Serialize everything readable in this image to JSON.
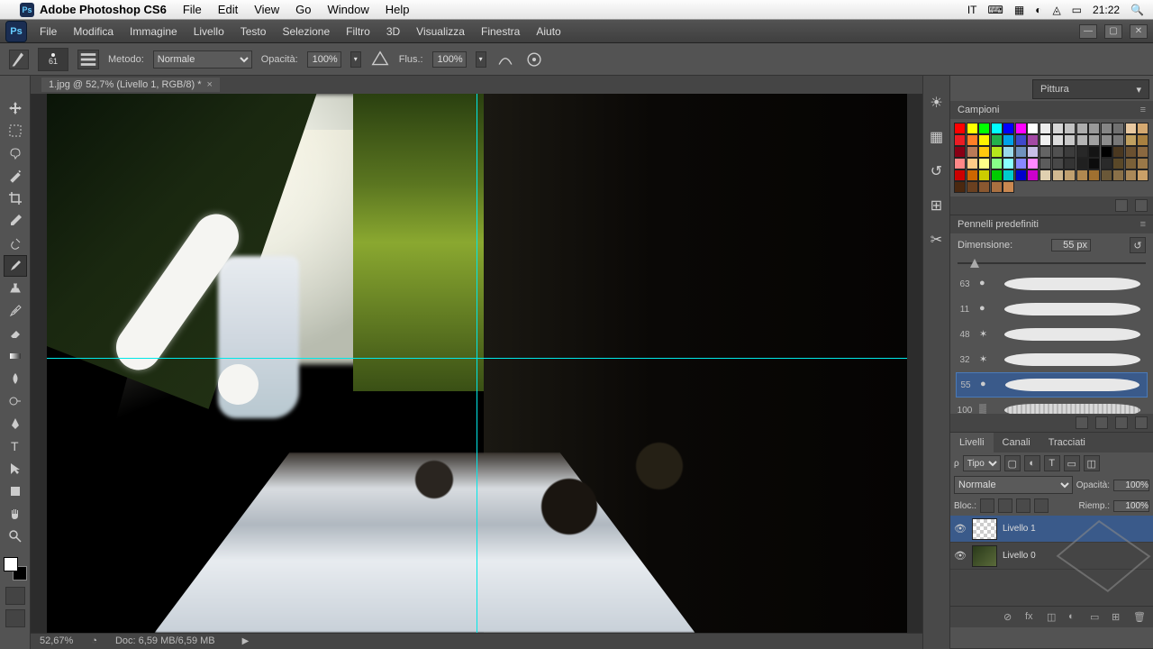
{
  "mac_menu": {
    "app_name": "Adobe Photoshop CS6",
    "items": [
      "File",
      "Edit",
      "View",
      "Go",
      "Window",
      "Help"
    ],
    "input_lang": "IT",
    "clock": "21:22"
  },
  "ps_menu": {
    "items": [
      "File",
      "Modifica",
      "Immagine",
      "Livello",
      "Testo",
      "Selezione",
      "Filtro",
      "3D",
      "Visualizza",
      "Finestra",
      "Aiuto"
    ]
  },
  "options": {
    "brush_size_label": "61",
    "metodo_label": "Metodo:",
    "metodo_value": "Normale",
    "opacita_label": "Opacità:",
    "opacita_value": "100%",
    "flusso_label": "Flus.:",
    "flusso_value": "100%"
  },
  "doc_tab": "1.jpg @ 52,7% (Livello 1, RGB/8) *",
  "status": {
    "zoom": "52,67%",
    "doc_info": "Doc: 6,59 MB/6,59 MB"
  },
  "workspace": "Pittura",
  "campioni": {
    "title": "Campioni",
    "colors": [
      "#ff0000",
      "#ffff00",
      "#00ff00",
      "#00ffff",
      "#0000ff",
      "#ff00ff",
      "#ffffff",
      "#ebebeb",
      "#d6d6d6",
      "#c2c2c2",
      "#adadad",
      "#999999",
      "#858585",
      "#707070",
      "#e8c8a0",
      "#d4a870",
      "#ec1c24",
      "#ff7f27",
      "#fff200",
      "#22b14c",
      "#00a2e8",
      "#3f48cc",
      "#a349a4",
      "#f0f0f0",
      "#dcdcdc",
      "#c8c8c8",
      "#b4b4b4",
      "#a0a0a0",
      "#8c8c8c",
      "#787878",
      "#c0a060",
      "#a88040",
      "#880015",
      "#b97a57",
      "#ffc90e",
      "#b5e61d",
      "#99d9ea",
      "#7092be",
      "#c8bfe7",
      "#646464",
      "#505050",
      "#3c3c3c",
      "#282828",
      "#141414",
      "#000000",
      "#4a3820",
      "#6a5030",
      "#8a6840",
      "#ff8888",
      "#ffcc88",
      "#ffff88",
      "#88ff88",
      "#88ffff",
      "#8888ff",
      "#ff88ff",
      "#5c5c5c",
      "#484848",
      "#343434",
      "#202020",
      "#0c0c0c",
      "#2a2a2a",
      "#5a4828",
      "#7a6038",
      "#9a7848",
      "#cc0000",
      "#cc6600",
      "#cccc00",
      "#00cc00",
      "#00cccc",
      "#0000cc",
      "#cc00cc",
      "#e0d0b0",
      "#d0b890",
      "#c0a070",
      "#b08850",
      "#a07030",
      "#6a5838",
      "#8a7048",
      "#aa8858",
      "#caa068",
      "#4a2810",
      "#6a4020",
      "#8a5830",
      "#aa7040",
      "#ca8850"
    ]
  },
  "brushes": {
    "title": "Pennelli predefiniti",
    "dim_label": "Dimensione:",
    "dim_value": "55 px",
    "list": [
      {
        "size": "63",
        "icon": "round"
      },
      {
        "size": "11",
        "icon": "round"
      },
      {
        "size": "48",
        "icon": "splat"
      },
      {
        "size": "32",
        "icon": "splat"
      },
      {
        "size": "55",
        "icon": "round",
        "selected": true
      },
      {
        "size": "100",
        "icon": "tex"
      }
    ]
  },
  "layers": {
    "tabs": [
      "Livelli",
      "Canali",
      "Tracciati"
    ],
    "filter_label": "Tipo",
    "blend_mode": "Normale",
    "opacita_label": "Opacità:",
    "opacita_value": "100%",
    "block_label": "Bloc.:",
    "riemp_label": "Riemp.:",
    "riemp_value": "100%",
    "items": [
      {
        "name": "Livello 1",
        "type": "transparent",
        "selected": true
      },
      {
        "name": "Livello 0",
        "type": "image"
      }
    ]
  },
  "tools": [
    "move",
    "marquee",
    "lasso",
    "wand",
    "crop",
    "eyedropper",
    "heal",
    "brush",
    "stamp",
    "history",
    "eraser",
    "gradient",
    "blur",
    "dodge",
    "pen",
    "type",
    "path",
    "shape",
    "hand",
    "zoom"
  ]
}
